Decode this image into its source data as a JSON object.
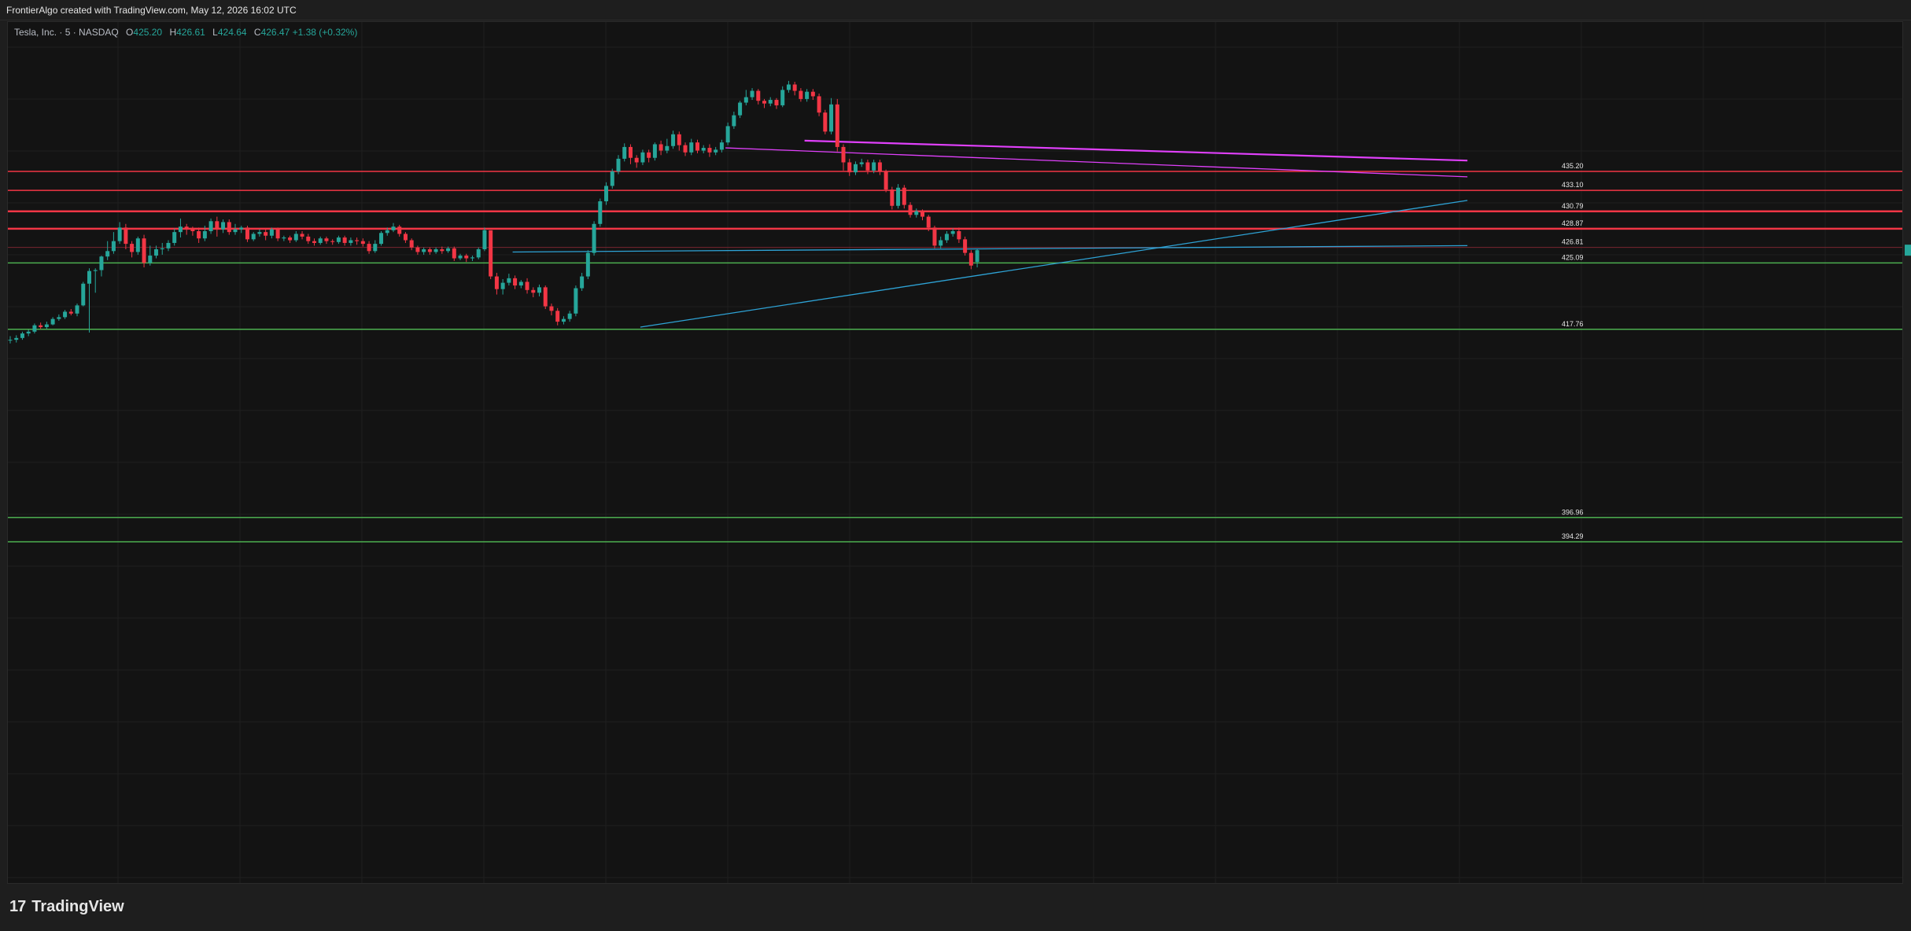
{
  "header": {
    "attribution": "FrontierAlgo created with TradingView.com, May 12, 2026 16:02 UTC"
  },
  "legend": {
    "symbol": "Tesla, Inc. · 5 · NASDAQ",
    "open_label": "O",
    "open": "425.20",
    "high_label": "H",
    "high": "426.61",
    "low_label": "L",
    "low": "424.64",
    "close_label": "C",
    "close": "426.47",
    "change": "+1.38 (+0.32%)"
  },
  "footer": {
    "brand": "TradingView"
  },
  "colors": {
    "up": "#26a69a",
    "down": "#f23645",
    "resistance": "#f23645",
    "support": "#4caf50",
    "trend_blue": "#2ea3d6",
    "trend_magenta": "#e040fb",
    "background": "#131313"
  },
  "chart_data": {
    "type": "candlestick",
    "symbol": "TSLA",
    "interval": "5",
    "ylim": [
      391.0,
      441.0
    ],
    "candles": [
      [
        416.6,
        416.6,
        416.2,
        417.0
      ],
      [
        416.6,
        416.8,
        416.3,
        417.1
      ],
      [
        416.8,
        417.3,
        416.6,
        417.5
      ],
      [
        417.3,
        417.5,
        417.0,
        417.7
      ],
      [
        417.5,
        418.2,
        417.3,
        418.4
      ],
      [
        418.2,
        418.0,
        417.8,
        418.5
      ],
      [
        418.0,
        418.3,
        417.8,
        418.6
      ],
      [
        418.3,
        418.9,
        418.2,
        419.1
      ],
      [
        418.9,
        419.1,
        418.7,
        419.4
      ],
      [
        419.1,
        419.7,
        418.9,
        419.9
      ],
      [
        419.7,
        419.5,
        419.3,
        420.0
      ],
      [
        419.5,
        420.4,
        419.2,
        420.6
      ],
      [
        420.4,
        422.8,
        420.3,
        423.0
      ],
      [
        422.8,
        424.2,
        417.4,
        424.5
      ],
      [
        424.2,
        424.3,
        421.8,
        424.5
      ],
      [
        424.3,
        425.8,
        423.6,
        425.9
      ],
      [
        425.8,
        426.4,
        425.4,
        427.5
      ],
      [
        426.4,
        427.5,
        426.1,
        428.5
      ],
      [
        427.5,
        429.0,
        427.2,
        429.6
      ],
      [
        429.0,
        427.2,
        426.6,
        429.4
      ],
      [
        427.2,
        426.3,
        425.7,
        427.5
      ],
      [
        426.3,
        427.8,
        426.0,
        428.0
      ],
      [
        427.8,
        425.1,
        424.6,
        428.2
      ],
      [
        425.1,
        425.9,
        424.8,
        427.0
      ],
      [
        425.9,
        426.6,
        425.6,
        427.0
      ],
      [
        426.6,
        426.7,
        426.0,
        427.3
      ],
      [
        426.7,
        427.3,
        426.4,
        427.6
      ],
      [
        427.3,
        428.5,
        427.0,
        428.9
      ],
      [
        428.5,
        429.1,
        427.9,
        430.0
      ],
      [
        429.1,
        428.8,
        428.2,
        429.4
      ],
      [
        428.8,
        428.6,
        428.1,
        429.1
      ],
      [
        428.6,
        427.8,
        427.3,
        429.0
      ],
      [
        427.8,
        428.6,
        427.5,
        429.2
      ],
      [
        428.6,
        429.7,
        428.3,
        430.0
      ],
      [
        429.7,
        428.8,
        428.0,
        430.2
      ],
      [
        428.8,
        429.6,
        428.4,
        429.9
      ],
      [
        429.6,
        428.5,
        428.2,
        429.9
      ],
      [
        428.5,
        428.8,
        428.2,
        429.4
      ],
      [
        428.8,
        429.0,
        428.4,
        429.2
      ],
      [
        429.0,
        427.7,
        427.4,
        429.2
      ],
      [
        427.7,
        428.3,
        427.5,
        428.5
      ],
      [
        428.3,
        428.5,
        428.0,
        428.8
      ],
      [
        428.5,
        428.1,
        427.6,
        428.8
      ],
      [
        428.1,
        428.8,
        427.8,
        429.0
      ],
      [
        428.8,
        427.8,
        427.5,
        429.0
      ],
      [
        427.8,
        427.9,
        427.5,
        428.1
      ],
      [
        427.9,
        427.6,
        427.3,
        428.1
      ],
      [
        427.6,
        428.3,
        427.4,
        428.6
      ],
      [
        428.3,
        428.0,
        427.7,
        428.6
      ],
      [
        428.0,
        427.5,
        427.2,
        428.3
      ],
      [
        427.5,
        427.3,
        427.0,
        427.8
      ],
      [
        427.3,
        427.8,
        427.1,
        428.0
      ],
      [
        427.8,
        427.5,
        427.2,
        428.0
      ],
      [
        427.5,
        427.4,
        427.1,
        427.7
      ],
      [
        427.4,
        427.9,
        427.2,
        428.1
      ],
      [
        427.9,
        427.3,
        427.0,
        428.1
      ],
      [
        427.3,
        427.6,
        427.0,
        427.9
      ],
      [
        427.6,
        427.5,
        427.1,
        427.9
      ],
      [
        427.5,
        427.2,
        426.9,
        427.8
      ],
      [
        427.2,
        426.4,
        426.1,
        427.5
      ],
      [
        426.4,
        427.2,
        426.2,
        427.6
      ],
      [
        427.2,
        428.4,
        427.0,
        428.6
      ],
      [
        428.4,
        428.7,
        428.1,
        429.0
      ],
      [
        428.7,
        429.1,
        428.5,
        429.5
      ],
      [
        429.1,
        428.3,
        428.0,
        429.3
      ],
      [
        428.3,
        427.6,
        427.3,
        428.5
      ],
      [
        427.6,
        426.8,
        426.5,
        427.8
      ],
      [
        426.8,
        426.3,
        426.0,
        427.0
      ],
      [
        426.3,
        426.6,
        426.0,
        426.8
      ],
      [
        426.6,
        426.3,
        426.0,
        426.8
      ],
      [
        426.3,
        426.6,
        426.1,
        426.8
      ],
      [
        426.6,
        426.4,
        426.1,
        426.9
      ],
      [
        426.4,
        426.7,
        426.2,
        426.9
      ],
      [
        426.7,
        425.6,
        425.3,
        426.9
      ],
      [
        425.6,
        425.9,
        425.4,
        426.1
      ],
      [
        425.9,
        425.6,
        425.2,
        426.1
      ],
      [
        425.6,
        425.7,
        425.3,
        425.9
      ],
      [
        425.7,
        426.6,
        425.5,
        426.8
      ],
      [
        426.6,
        428.7,
        426.4,
        429.0
      ],
      [
        428.7,
        423.6,
        423.3,
        424.2
      ],
      [
        423.6,
        422.2,
        421.6,
        424.0
      ],
      [
        422.2,
        422.9,
        421.6,
        423.3
      ],
      [
        422.9,
        423.4,
        422.6,
        423.9
      ],
      [
        423.4,
        422.6,
        422.2,
        423.7
      ],
      [
        422.6,
        423.0,
        422.3,
        423.2
      ],
      [
        423.0,
        422.1,
        421.7,
        423.4
      ],
      [
        422.1,
        421.8,
        421.3,
        422.4
      ],
      [
        421.8,
        422.4,
        421.4,
        422.7
      ],
      [
        422.4,
        420.3,
        420.0,
        422.6
      ],
      [
        420.3,
        419.8,
        419.3,
        420.6
      ],
      [
        419.8,
        418.6,
        418.2,
        420.1
      ],
      [
        418.6,
        418.9,
        418.3,
        419.2
      ],
      [
        418.9,
        419.5,
        418.6,
        419.8
      ],
      [
        419.5,
        422.3,
        419.2,
        422.6
      ],
      [
        422.3,
        423.6,
        422.0,
        424.0
      ],
      [
        423.6,
        426.2,
        423.3,
        426.5
      ],
      [
        426.2,
        429.4,
        425.9,
        429.7
      ],
      [
        429.4,
        431.9,
        429.1,
        432.2
      ],
      [
        431.9,
        433.6,
        431.5,
        434.0
      ],
      [
        433.6,
        435.2,
        433.3,
        435.5
      ],
      [
        435.2,
        436.6,
        434.9,
        437.0
      ],
      [
        436.6,
        437.9,
        436.3,
        438.3
      ],
      [
        437.9,
        436.7,
        436.0,
        438.2
      ],
      [
        436.7,
        436.2,
        435.6,
        437.0
      ],
      [
        436.2,
        437.3,
        435.9,
        437.6
      ],
      [
        437.3,
        436.7,
        436.2,
        437.6
      ],
      [
        436.7,
        438.2,
        436.4,
        438.4
      ],
      [
        438.2,
        437.5,
        437.0,
        438.6
      ],
      [
        437.5,
        438.0,
        437.2,
        438.8
      ],
      [
        438.0,
        439.3,
        437.7,
        439.7
      ],
      [
        439.3,
        438.1,
        437.5,
        439.6
      ],
      [
        438.1,
        437.3,
        436.9,
        438.4
      ],
      [
        437.3,
        438.4,
        437.0,
        438.8
      ],
      [
        438.4,
        437.5,
        437.2,
        438.7
      ],
      [
        437.5,
        437.8,
        437.2,
        438.1
      ],
      [
        437.8,
        437.3,
        436.8,
        438.2
      ],
      [
        437.3,
        437.6,
        437.0,
        437.9
      ],
      [
        437.6,
        438.4,
        437.3,
        438.7
      ],
      [
        438.4,
        440.2,
        438.1,
        440.6
      ],
      [
        440.2,
        441.4,
        439.9,
        441.8
      ],
      [
        441.4,
        442.8,
        441.1,
        443.0
      ],
      [
        442.8,
        443.4,
        442.5,
        444.2
      ],
      [
        443.4,
        444.1,
        443.1,
        444.4
      ],
      [
        444.1,
        443.0,
        442.6,
        444.3
      ],
      [
        443.0,
        442.7,
        442.2,
        443.2
      ],
      [
        442.7,
        443.1,
        442.4,
        443.4
      ],
      [
        443.1,
        442.5,
        442.1,
        443.3
      ],
      [
        442.5,
        444.2,
        442.3,
        444.6
      ],
      [
        444.2,
        444.8,
        443.9,
        445.2
      ],
      [
        444.8,
        444.1,
        443.6,
        445.1
      ],
      [
        444.1,
        443.2,
        442.9,
        444.4
      ],
      [
        443.2,
        444.0,
        442.9,
        444.3
      ],
      [
        444.0,
        443.5,
        443.1,
        444.3
      ],
      [
        443.5,
        441.7,
        441.3,
        443.8
      ],
      [
        441.7,
        439.6,
        439.3,
        442.0
      ],
      [
        439.6,
        442.6,
        439.3,
        443.3
      ],
      [
        442.6,
        437.9,
        437.4,
        443.2
      ],
      [
        437.9,
        436.2,
        435.3,
        438.2
      ],
      [
        436.2,
        435.1,
        434.7,
        436.6
      ],
      [
        435.1,
        436.0,
        434.8,
        436.3
      ],
      [
        436.0,
        436.2,
        435.7,
        436.6
      ],
      [
        436.2,
        435.3,
        434.9,
        436.5
      ],
      [
        435.3,
        436.2,
        435.0,
        436.5
      ],
      [
        436.2,
        435.2,
        434.8,
        436.5
      ],
      [
        435.2,
        433.2,
        432.9,
        435.4
      ],
      [
        433.2,
        431.4,
        431.0,
        433.5
      ],
      [
        431.4,
        433.4,
        431.1,
        433.8
      ],
      [
        433.4,
        431.5,
        431.1,
        433.7
      ],
      [
        431.5,
        430.4,
        430.1,
        431.8
      ],
      [
        430.4,
        430.8,
        430.1,
        431.1
      ],
      [
        430.8,
        430.2,
        429.8,
        431.0
      ],
      [
        430.2,
        429.0,
        428.6,
        430.4
      ],
      [
        429.0,
        427.0,
        426.7,
        429.2
      ],
      [
        427.0,
        427.6,
        426.7,
        428.0
      ],
      [
        427.6,
        428.3,
        427.3,
        428.6
      ],
      [
        428.3,
        428.6,
        428.0,
        428.9
      ],
      [
        428.6,
        427.7,
        427.3,
        429.0
      ],
      [
        427.7,
        426.2,
        425.9,
        428.0
      ],
      [
        426.2,
        424.8,
        424.4,
        426.5
      ],
      [
        425.2,
        426.5,
        424.6,
        426.6
      ]
    ],
    "levels": [
      {
        "price": 435.2,
        "label": "435.20",
        "kind": "resistance"
      },
      {
        "price": 433.1,
        "label": "433.10",
        "kind": "resistance"
      },
      {
        "price": 430.79,
        "label": "430.79",
        "kind": "resistance"
      },
      {
        "price": 428.87,
        "label": "428.87",
        "kind": "resistance"
      },
      {
        "price": 426.81,
        "label": "426.81",
        "kind": "resistance-thin"
      },
      {
        "price": 425.09,
        "label": "425.09",
        "kind": "support"
      },
      {
        "price": 417.76,
        "label": "417.76",
        "kind": "support"
      },
      {
        "price": 396.96,
        "label": "396.96",
        "kind": "support"
      },
      {
        "price": 394.29,
        "label": "394.29",
        "kind": "support"
      }
    ],
    "trendlines": [
      {
        "name": "blue-flat",
        "color": "trend_blue",
        "from": [
          83,
          426.3
        ],
        "to": [
          240,
          427.0
        ]
      },
      {
        "name": "blue-rising",
        "color": "trend_blue",
        "from": [
          104,
          418.0
        ],
        "to": [
          240,
          432.0
        ]
      },
      {
        "name": "magenta-thin",
        "color": "trend_magenta",
        "from": [
          118,
          437.8
        ],
        "to": [
          240,
          434.6
        ]
      },
      {
        "name": "magenta-thick",
        "color": "trend_magenta",
        "from": [
          131,
          438.6
        ],
        "to": [
          240,
          436.4
        ]
      }
    ]
  }
}
